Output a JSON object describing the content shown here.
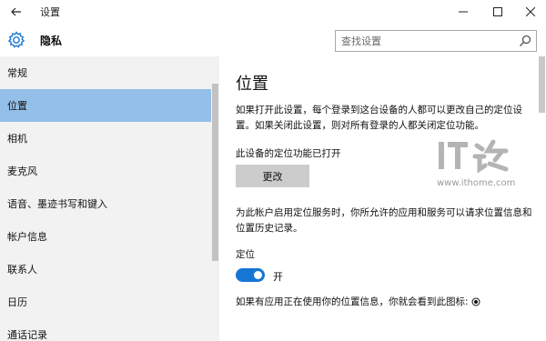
{
  "window": {
    "title": "设置"
  },
  "header": {
    "title": "隐私",
    "search_placeholder": "查找设置"
  },
  "sidebar": {
    "items": [
      {
        "label": "常规"
      },
      {
        "label": "位置",
        "active": true
      },
      {
        "label": "相机"
      },
      {
        "label": "麦克风"
      },
      {
        "label": "语音、墨迹书写和键入"
      },
      {
        "label": "帐户信息"
      },
      {
        "label": "联系人"
      },
      {
        "label": "日历"
      },
      {
        "label": "通话记录"
      }
    ]
  },
  "main": {
    "title": "位置",
    "intro": "如果打开此设置，每个登录到这台设备的人都可以更改自己的定位设置。如果关闭此设置，则对所有登录的人都关闭定位功能。",
    "device_status": "此设备的定位功能已打开",
    "change_button": "更改",
    "account_desc": "为此帐户启用定位服务时，你所允许的应用和服务可以请求位置信息和位置历史记录。",
    "location_label": "定位",
    "toggle_state": "开",
    "toggle_on": true,
    "icon_hint": "如果有应用正在使用你的位置信息，你就会看到此图标:"
  },
  "watermark": {
    "logo_text": "IT之家",
    "url": "www.ithome.com"
  },
  "colors": {
    "accent": "#1676d3",
    "sidebar_bg": "#f2f2f2",
    "selected_bg": "#94bfe8"
  }
}
